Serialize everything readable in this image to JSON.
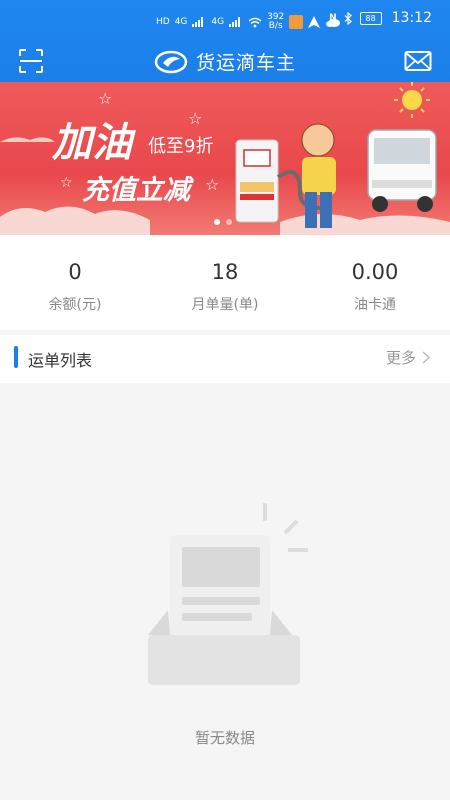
{
  "status_bar": {
    "network_left": "HD",
    "signal1": "4G",
    "signal2": "4G",
    "speed_value": "392",
    "speed_unit": "B/s",
    "battery": "88",
    "time": "13:12"
  },
  "header": {
    "title": "货运滴车主",
    "scan_icon": "scan-icon",
    "mail_icon": "mail-icon"
  },
  "banner": {
    "line1": "加油",
    "line2": "低至9折",
    "line3": "充值立减",
    "pager_count": 2,
    "pager_active": 0
  },
  "stats": [
    {
      "value": "0",
      "label": "余额(元)"
    },
    {
      "value": "18",
      "label": "月单量(单)"
    },
    {
      "value": "0.00",
      "label": "油卡通"
    }
  ],
  "list": {
    "title": "运单列表",
    "more": "更多"
  },
  "empty": {
    "message": "暂无数据"
  },
  "colors": {
    "primary": "#1b7fe9",
    "banner_red": "#e9484b",
    "background": "#f5f5f5"
  }
}
